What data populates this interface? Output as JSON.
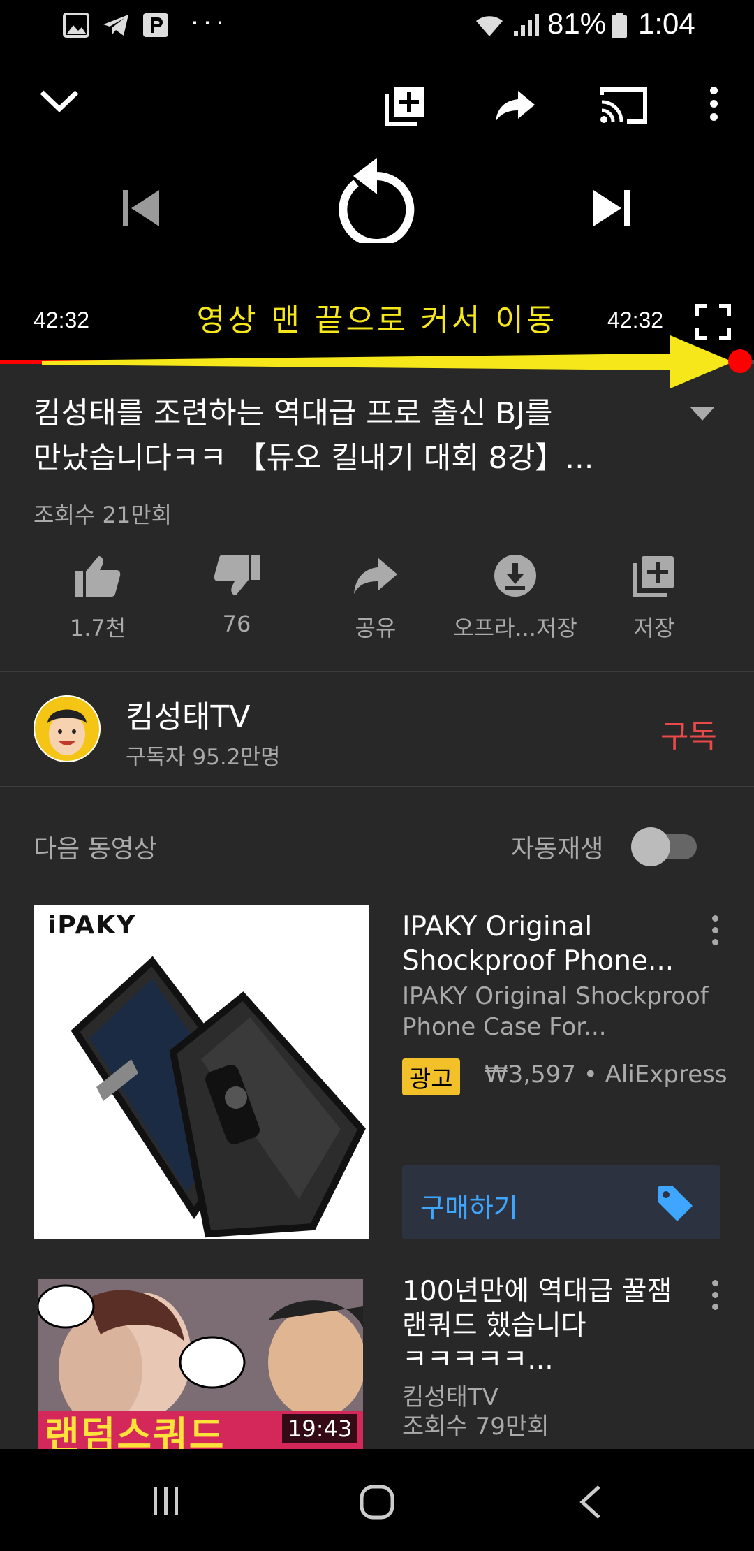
{
  "status_bar": {
    "battery": "81%",
    "time": "1:04",
    "notification_icons": [
      "gallery-icon",
      "telegram-icon",
      "parking-icon",
      "more-notifications-icon"
    ]
  },
  "player": {
    "time_elapsed": "42:32",
    "time_total": "42:32",
    "annotation": "영상 맨 끝으로 커서 이동",
    "progress": 1.0,
    "accent_color": "#ff0000",
    "annotation_color": "#f5e71a"
  },
  "video": {
    "title_line1": "킴성태를 조련하는 역대급 프로 출신 BJ를",
    "title_line2": "만났습니다ㅋㅋ 【듀오 킬내기 대회 8강】...",
    "views": "조회수 21만회"
  },
  "actions": [
    {
      "label": "1.7천",
      "icon": "thumbs-up-icon"
    },
    {
      "label": "76",
      "icon": "thumbs-down-icon"
    },
    {
      "label": "공유",
      "icon": "share-icon"
    },
    {
      "label": "오프라...저장",
      "icon": "download-icon"
    },
    {
      "label": "저장",
      "icon": "add-to-playlist-icon"
    }
  ],
  "channel": {
    "name": "킴성태TV",
    "subscribers": "구독자 95.2만명",
    "subscribe_label": "구독",
    "subscribe_color": "#e94949"
  },
  "up_next": {
    "label": "다음 동영상",
    "autoplay_label": "자동재생"
  },
  "ad": {
    "title": "IPAKY Original Shockproof Phone...",
    "subtitle": "IPAKY Original Shockproof Phone Case For...",
    "badge": "광고",
    "price": "₩3,597 • AliExpress",
    "buy_label": "구매하기",
    "thumb_brand": "iPAKY"
  },
  "next_video": {
    "title_line1": "100년만에 역대급 꿀잼",
    "title_line2": "랜쿼드 했습니다",
    "title_line3": "ㅋㅋㅋㅋㅋ...",
    "channel": "킴성태TV",
    "views": "조회수 79만회",
    "duration": "19:43",
    "thumb_text": "랜덤스쿼드"
  }
}
